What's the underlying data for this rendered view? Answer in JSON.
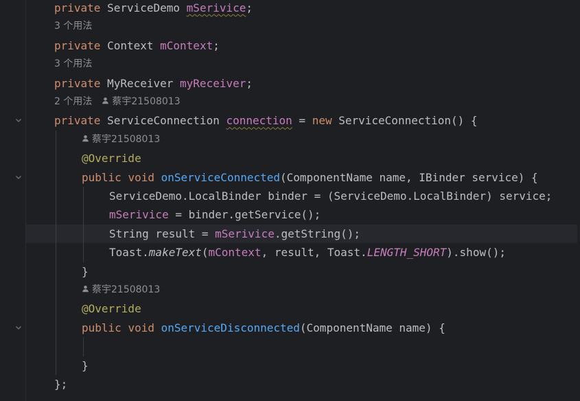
{
  "editor": {
    "lines": [
      {
        "type": "code",
        "tokens": [
          {
            "t": "private",
            "c": "kw"
          },
          {
            "t": " ServiceDemo ",
            "c": "type"
          },
          {
            "t": "mSerivice",
            "c": "field squiggle"
          },
          {
            "t": ";",
            "c": "type"
          }
        ]
      },
      {
        "type": "hint",
        "usages": "3 个用法"
      },
      {
        "type": "code",
        "tokens": [
          {
            "t": "private",
            "c": "kw"
          },
          {
            "t": " Context ",
            "c": "type"
          },
          {
            "t": "mContext",
            "c": "field"
          },
          {
            "t": ";",
            "c": "type"
          }
        ]
      },
      {
        "type": "hint",
        "usages": "3 个用法"
      },
      {
        "type": "code",
        "tokens": [
          {
            "t": "private",
            "c": "kw"
          },
          {
            "t": " MyReceiver ",
            "c": "type"
          },
          {
            "t": "myReceiver",
            "c": "field"
          },
          {
            "t": ";",
            "c": "type"
          }
        ]
      },
      {
        "type": "hint",
        "usages": "2 个用法",
        "author": "蔡宇21508013"
      },
      {
        "type": "code",
        "fold": true,
        "tokens": [
          {
            "t": "private",
            "c": "kw"
          },
          {
            "t": " ServiceConnection ",
            "c": "type"
          },
          {
            "t": "connection",
            "c": "field squiggle"
          },
          {
            "t": " = ",
            "c": "type"
          },
          {
            "t": "new",
            "c": "kw"
          },
          {
            "t": " ServiceConnection() {",
            "c": "type"
          }
        ]
      },
      {
        "type": "hint",
        "indent": 1,
        "author": "蔡宇21508013"
      },
      {
        "type": "code",
        "indent": 1,
        "tokens": [
          {
            "t": "@Override",
            "c": "ann"
          }
        ]
      },
      {
        "type": "code",
        "indent": 1,
        "fold": true,
        "tokens": [
          {
            "t": "public",
            "c": "kw"
          },
          {
            "t": " ",
            "c": "type"
          },
          {
            "t": "void",
            "c": "kw"
          },
          {
            "t": " ",
            "c": "type"
          },
          {
            "t": "onServiceConnected",
            "c": "method"
          },
          {
            "t": "(ComponentName name, IBinder service) {",
            "c": "type"
          }
        ]
      },
      {
        "type": "code",
        "indent": 2,
        "tokens": [
          {
            "t": "ServiceDemo.LocalBinder binder = (ServiceDemo.LocalBinder) service;",
            "c": "type"
          }
        ]
      },
      {
        "type": "code",
        "indent": 2,
        "tokens": [
          {
            "t": "mSerivice",
            "c": "field"
          },
          {
            "t": " = binder.getService();",
            "c": "type"
          }
        ]
      },
      {
        "type": "code",
        "indent": 2,
        "current": true,
        "tokens": [
          {
            "t": "String result = ",
            "c": "type"
          },
          {
            "t": "mSerivice",
            "c": "field"
          },
          {
            "t": ".getString();",
            "c": "type"
          }
        ]
      },
      {
        "type": "code",
        "indent": 2,
        "tokens": [
          {
            "t": "Toast.",
            "c": "type"
          },
          {
            "t": "makeText",
            "c": "type italic"
          },
          {
            "t": "(",
            "c": "type"
          },
          {
            "t": "mContext",
            "c": "field"
          },
          {
            "t": ", result, Toast.",
            "c": "type"
          },
          {
            "t": "LENGTH_SHORT",
            "c": "field italic"
          },
          {
            "t": ").show();",
            "c": "type"
          }
        ]
      },
      {
        "type": "code",
        "indent": 1,
        "tokens": [
          {
            "t": "}",
            "c": "type"
          }
        ]
      },
      {
        "type": "hint",
        "indent": 1,
        "author": "蔡宇21508013"
      },
      {
        "type": "code",
        "indent": 1,
        "tokens": [
          {
            "t": "@Override",
            "c": "ann"
          }
        ]
      },
      {
        "type": "code",
        "indent": 1,
        "fold": true,
        "tokens": [
          {
            "t": "public",
            "c": "kw"
          },
          {
            "t": " ",
            "c": "type"
          },
          {
            "t": "void",
            "c": "kw"
          },
          {
            "t": " ",
            "c": "type"
          },
          {
            "t": "onServiceDisconnected",
            "c": "method"
          },
          {
            "t": "(ComponentName name) {",
            "c": "type"
          }
        ]
      },
      {
        "type": "code",
        "indent": 1,
        "tokens": []
      },
      {
        "type": "code",
        "indent": 1,
        "tokens": [
          {
            "t": "}",
            "c": "type"
          }
        ]
      },
      {
        "type": "code",
        "tokens": [
          {
            "t": "};",
            "c": "type"
          }
        ]
      }
    ],
    "fold_icon": "chevron-down-icon",
    "author_icon": "person-icon"
  }
}
